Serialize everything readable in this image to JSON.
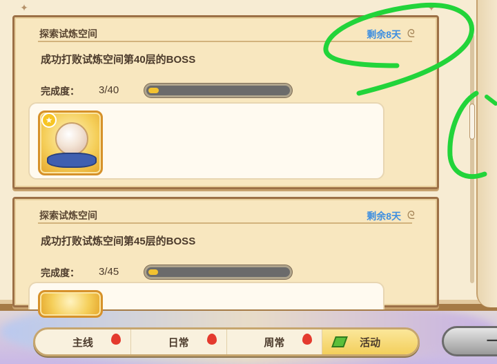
{
  "quests": [
    {
      "category": "探索试炼空间",
      "time_left": "剩余8天",
      "description": "成功打败试炼空间第40层的BOSS",
      "progress_label": "完成度：",
      "progress_text": "3/40",
      "progress_fraction": 0.075
    },
    {
      "category": "探索试炼空间",
      "time_left": "剩余8天",
      "description": "成功打败试炼空间第45层的BOSS",
      "progress_label": "完成度：",
      "progress_text": "3/45",
      "progress_fraction": 0.067
    }
  ],
  "tabs": [
    {
      "label": "主线",
      "badge": true,
      "active": false
    },
    {
      "label": "日常",
      "badge": true,
      "active": false
    },
    {
      "label": "周常",
      "badge": true,
      "active": false
    },
    {
      "label": "活动",
      "badge": false,
      "active": true
    }
  ],
  "side_button_label": "一",
  "colors": {
    "time_left": "#3f8fe0",
    "progress_fill": "#f2c230",
    "scribble": "#22d43a"
  }
}
